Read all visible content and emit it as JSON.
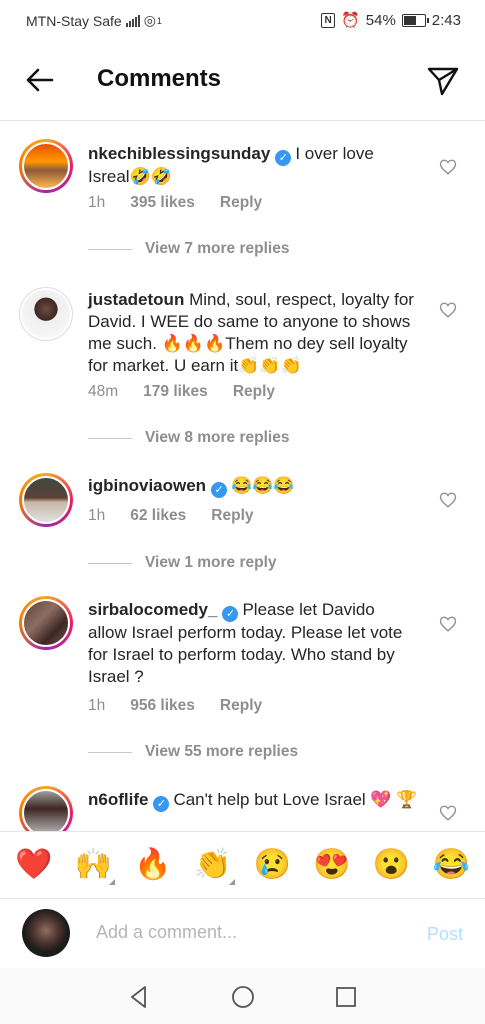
{
  "status": {
    "carrier": "MTN-Stay Safe",
    "signal_sup": "1",
    "battery_pct": "54%",
    "battery_level": 0.54,
    "time": "2:43"
  },
  "header": {
    "title": "Comments"
  },
  "comments": [
    {
      "username": "nkechiblessingsunday",
      "verified": true,
      "text": "I over love Isreal🤣🤣",
      "time": "1h",
      "likes": "395 likes",
      "reply": "Reply",
      "more": "View 7 more replies",
      "avatar_ring": true
    },
    {
      "username": "justadetoun",
      "verified": false,
      "text": "Mind, soul, respect, loyalty for David. I WEE do same to anyone to shows me such. 🔥🔥🔥Them no dey sell loyalty for market. U earn it👏👏👏",
      "time": "48m",
      "likes": "179 likes",
      "reply": "Reply",
      "more": "View 8 more replies",
      "avatar_ring": false
    },
    {
      "username": "igbinoviaowen",
      "verified": true,
      "text": "😂😂😂",
      "time": "1h",
      "likes": "62 likes",
      "reply": "Reply",
      "more": "View 1 more reply",
      "avatar_ring": true
    },
    {
      "username": "sirbalocomedy_",
      "verified": true,
      "text": "Please let Davido allow Israel perform today.  Please let vote for Israel to perform today. Who stand by Israel ?",
      "time": "1h",
      "likes": "956 likes",
      "reply": "Reply",
      "more": "View 55 more replies",
      "avatar_ring": true
    },
    {
      "username": "n6oflife",
      "verified": true,
      "text": "Can't help but Love Israel 💖 🏆",
      "avatar_ring": true
    }
  ],
  "emoji_bar": [
    "❤️",
    "🙌",
    "🔥",
    "👏",
    "😢",
    "😍",
    "😮",
    "😂"
  ],
  "composer": {
    "placeholder": "Add a comment...",
    "post_label": "Post"
  },
  "icons": {
    "back": "back-arrow-icon",
    "send": "direct-send-icon",
    "heart": "heart-outline-icon",
    "nav_back": "nav-back-icon",
    "nav_home": "nav-home-icon",
    "nav_recents": "nav-recents-icon"
  }
}
